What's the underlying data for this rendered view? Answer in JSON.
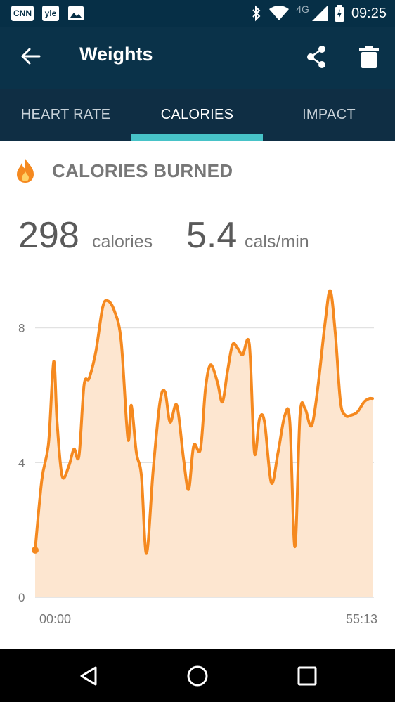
{
  "status_bar": {
    "notifications": [
      "CNN",
      "yle"
    ],
    "network": "4G",
    "time": "09:25"
  },
  "app_bar": {
    "title": "Weights"
  },
  "tabs": [
    {
      "label": "HEART RATE",
      "active": false
    },
    {
      "label": "CALORIES",
      "active": true
    },
    {
      "label": "IMPACT",
      "active": false
    }
  ],
  "section": {
    "title": "CALORIES BURNED"
  },
  "stats": {
    "total_value": "298",
    "total_unit": "calories",
    "rate_value": "5.4",
    "rate_unit": "cals/min"
  },
  "colors": {
    "status_bar": "#062f46",
    "app_bar": "#0a3249",
    "tab_bar": "#0f2e44",
    "tab_indicator": "#47c3c8",
    "line": "#f5891f",
    "area": "#fde6d0"
  },
  "chart_data": {
    "type": "area",
    "x_start_label": "00:00",
    "x_end_label": "55:13",
    "duration_seconds": 3313,
    "y_ticks": [
      0,
      4,
      8
    ],
    "ylim": [
      0,
      9.2
    ],
    "grid": true,
    "series": [
      {
        "x": [
          0,
          0.02,
          0.04,
          0.055,
          0.065,
          0.08,
          0.1,
          0.115,
          0.13,
          0.145,
          0.16,
          0.18,
          0.2,
          0.215,
          0.235,
          0.255,
          0.275,
          0.285,
          0.3,
          0.315,
          0.33,
          0.35,
          0.37,
          0.385,
          0.4,
          0.42,
          0.44,
          0.455,
          0.47,
          0.49,
          0.505,
          0.52,
          0.54,
          0.555,
          0.57,
          0.585,
          0.6,
          0.615,
          0.635,
          0.65,
          0.665,
          0.68,
          0.7,
          0.72,
          0.74,
          0.755,
          0.77,
          0.785,
          0.8,
          0.815,
          0.825,
          0.84,
          0.86,
          0.875,
          0.89,
          0.905,
          0.92,
          0.935,
          0.955,
          0.975,
          0.99,
          1.0
        ],
        "y": [
          1.4,
          3.5,
          4.6,
          7.0,
          5.2,
          3.6,
          3.9,
          4.4,
          4.2,
          6.3,
          6.5,
          7.3,
          8.6,
          8.8,
          8.5,
          7.6,
          4.7,
          5.7,
          4.3,
          3.6,
          1.3,
          3.8,
          5.8,
          6.1,
          5.2,
          5.7,
          4.1,
          3.2,
          4.5,
          4.4,
          6.2,
          6.9,
          6.4,
          5.8,
          6.7,
          7.5,
          7.4,
          7.2,
          7.5,
          4.3,
          5.3,
          5.2,
          3.4,
          4.3,
          5.4,
          5.2,
          1.5,
          5.4,
          5.6,
          5.1,
          5.3,
          6.4,
          8.2,
          9.1,
          7.8,
          5.8,
          5.4,
          5.4,
          5.5,
          5.8,
          5.9,
          5.9
        ]
      }
    ]
  }
}
